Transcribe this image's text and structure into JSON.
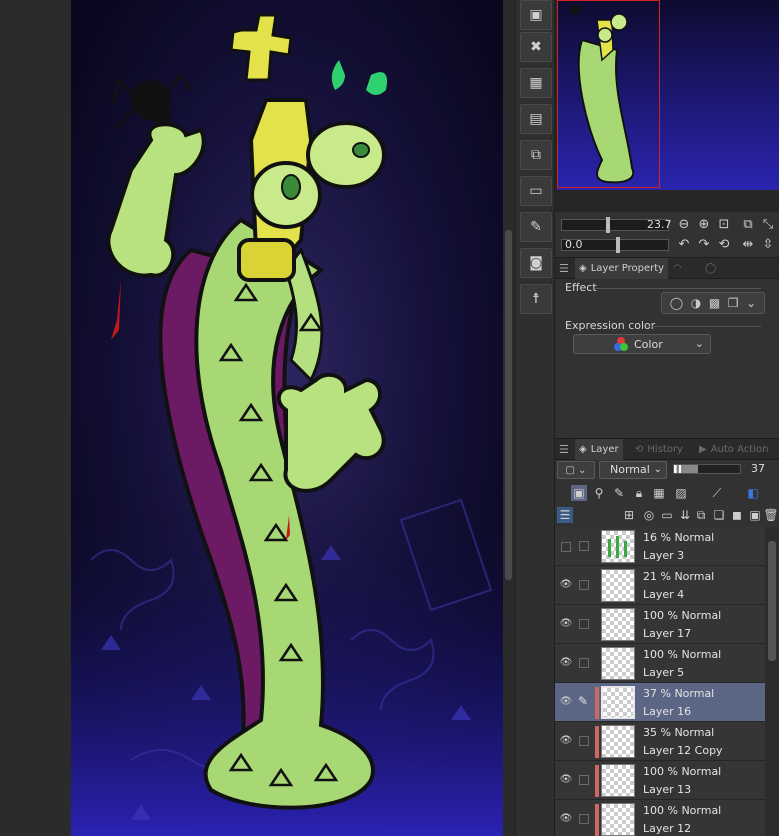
{
  "canvas": {
    "artwork": "Cartoon chess-king monster with green snake-patterned robe holding a spider"
  },
  "tool_column": {
    "icons": [
      "save-icon",
      "delete-icon",
      "grid-icon",
      "layer-settings-icon",
      "transform-icon",
      "folder-icon",
      "edit-icon",
      "camera-icon",
      "figure-icon"
    ]
  },
  "navigator": {
    "zoom": "23.7",
    "angle": "0.0"
  },
  "layer_property": {
    "tabs": [
      "Layer Property",
      "",
      ""
    ],
    "effect_label": "Effect",
    "expression_label": "Expression color",
    "expression_value": "Color"
  },
  "layer_panel": {
    "tabs": [
      "Layer",
      "History",
      "Auto Action"
    ],
    "blend_mode": "Normal",
    "opacity": "37",
    "layers": [
      {
        "mode": "16 % Normal",
        "name": "Layer 3",
        "visible": false,
        "selected": false,
        "marked": false
      },
      {
        "mode": "21 % Normal",
        "name": "Layer 4",
        "visible": true,
        "selected": false,
        "marked": false
      },
      {
        "mode": "100 % Normal",
        "name": "Layer 17",
        "visible": true,
        "selected": false,
        "marked": false
      },
      {
        "mode": "100 % Normal",
        "name": "Layer 5",
        "visible": true,
        "selected": false,
        "marked": false
      },
      {
        "mode": "37 % Normal",
        "name": "Layer 16",
        "visible": true,
        "selected": true,
        "marked": true
      },
      {
        "mode": "35 % Normal",
        "name": "Layer 12 Copy",
        "visible": true,
        "selected": false,
        "marked": true
      },
      {
        "mode": "100 % Normal",
        "name": "Layer 13",
        "visible": true,
        "selected": false,
        "marked": true
      },
      {
        "mode": "100 % Normal",
        "name": "Layer 12",
        "visible": true,
        "selected": false,
        "marked": true
      }
    ]
  },
  "colors": {
    "selected_row": "#5b6584",
    "layer_mark": "#d06767",
    "nav_frame": "#d32020"
  }
}
